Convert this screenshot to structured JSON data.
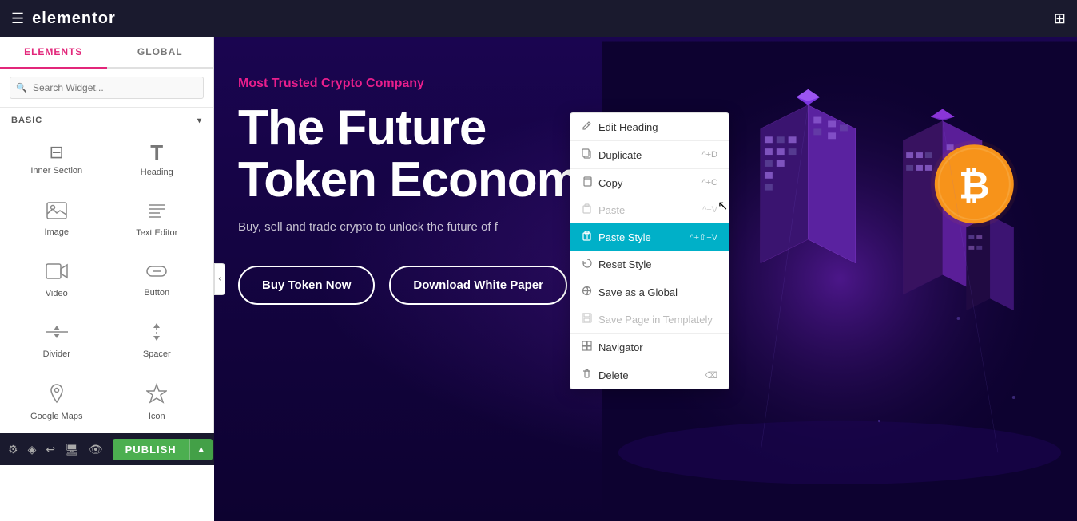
{
  "topbar": {
    "logo": "elementor",
    "hamburger_label": "menu",
    "grid_label": "apps"
  },
  "sidebar": {
    "tab_elements": "ELEMENTS",
    "tab_global": "GLOBAL",
    "search_placeholder": "Search Widget...",
    "section_label": "BASIC",
    "widgets": [
      {
        "id": "inner-section",
        "icon": "inner-section",
        "label": "Inner Section"
      },
      {
        "id": "heading",
        "icon": "heading",
        "label": "Heading"
      },
      {
        "id": "image",
        "icon": "image",
        "label": "Image"
      },
      {
        "id": "text-editor",
        "icon": "text-editor",
        "label": "Text Editor"
      },
      {
        "id": "video",
        "icon": "video",
        "label": "Video"
      },
      {
        "id": "button",
        "icon": "button",
        "label": "Button"
      },
      {
        "id": "divider",
        "icon": "divider",
        "label": "Divider"
      },
      {
        "id": "spacer",
        "icon": "spacer",
        "label": "Spacer"
      },
      {
        "id": "google-maps",
        "icon": "google-maps",
        "label": "Google Maps"
      },
      {
        "id": "icon",
        "icon": "icon",
        "label": "Icon"
      }
    ]
  },
  "canvas": {
    "tag": "Most Trusted Crypto Company",
    "heading_line1": "The Future",
    "heading_line2": "Token Economy",
    "subtext": "Buy, sell and trade crypto to unlock the future of f",
    "btn1": "Buy Token Now",
    "btn2": "Download White Paper"
  },
  "context_menu": {
    "items": [
      {
        "id": "edit-heading",
        "icon": "✏️",
        "label": "Edit Heading",
        "shortcut": "",
        "active": false,
        "disabled": false
      },
      {
        "id": "duplicate",
        "icon": "📋",
        "label": "Duplicate",
        "shortcut": "^+D",
        "active": false,
        "disabled": false
      },
      {
        "id": "copy",
        "icon": "📄",
        "label": "Copy",
        "shortcut": "^+C",
        "active": false,
        "disabled": false
      },
      {
        "id": "paste",
        "icon": "📎",
        "label": "Paste",
        "shortcut": "^+V",
        "active": false,
        "disabled": true
      },
      {
        "id": "paste-style",
        "icon": "🎨",
        "label": "Paste Style",
        "shortcut": "^+⇧+V",
        "active": true,
        "disabled": false
      },
      {
        "id": "reset-style",
        "icon": "",
        "label": "Reset Style",
        "shortcut": "",
        "active": false,
        "disabled": false
      },
      {
        "id": "save-global",
        "icon": "",
        "label": "Save as a Global",
        "shortcut": "",
        "active": false,
        "disabled": false
      },
      {
        "id": "save-template",
        "icon": "💾",
        "label": "Save Page in Templately",
        "shortcut": "",
        "active": false,
        "disabled": false
      },
      {
        "id": "navigator",
        "icon": "",
        "label": "Navigator",
        "shortcut": "",
        "active": false,
        "disabled": false
      },
      {
        "id": "delete",
        "icon": "🗑️",
        "label": "Delete",
        "shortcut": "⌫",
        "active": false,
        "disabled": false
      }
    ]
  },
  "bottombar": {
    "publish_label": "PUBLISH",
    "arrow_label": "▲"
  },
  "colors": {
    "pink": "#e91e8c",
    "teal_active": "#00b0c8",
    "green_publish": "#4CAF50"
  }
}
